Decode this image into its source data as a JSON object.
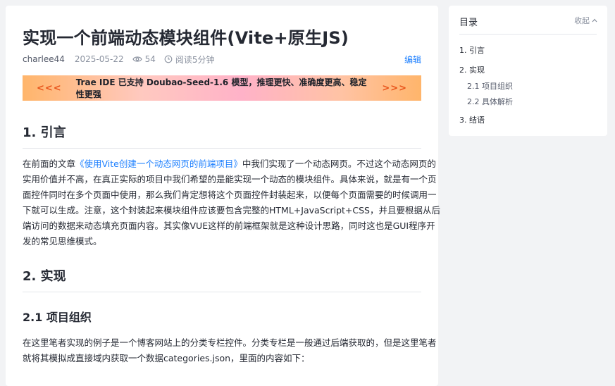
{
  "article": {
    "title": "实现一个前端动态模块组件(Vite+原生JS)",
    "author": "charlee44",
    "date": "2025-05-22",
    "views": "54",
    "read_time": "阅读5分钟",
    "edit_label": "编辑"
  },
  "banner": {
    "left_arrows": "<<<",
    "text": "Trae IDE 已支持 Doubao-Seed-1.6 模型，推理更快、准确度更高、稳定性更强",
    "right_arrows": ">>>"
  },
  "sections": {
    "s1_heading": "1. 引言",
    "s1_lines": [
      {
        "pre": "在前面的文章",
        "link": "《使用Vite创建一个动态网页的前端项目》",
        "post": "中我们实现了一个动态网页。不过这个动态网页的"
      },
      "实用价值并不高，在真正实际的项目中我们希望的是能实现一个动态的模块组件。具体来说，就是有一个页",
      "面控件同时在多个页面中使用，那么我们肯定想将这个页面控件封装起来，以便每个页面需要的时候调用一",
      "下就可以生成。注意，这个封装起来模块组件应该要包含完整的HTML+JavaScript+CSS，并且要根据从后",
      "端访问的数据来动态填充页面内容。其实像VUE这样的前端框架就是这种设计思路，同时这也是GUI程序开",
      "发的常见思维模式。"
    ],
    "s2_heading": "2. 实现",
    "s21_heading": "2.1 项目组织",
    "s21_lines": [
      "在这里笔者实现的例子是一个博客网站上的分类专栏控件。分类专栏是一般通过后端获取的，但是这里笔者",
      "就将其模拟成直接域内获取一个数据categories.json，里面的内容如下："
    ]
  },
  "toc": {
    "title": "目录",
    "collapse_label": "收起",
    "items": [
      "1. 引言",
      "2. 实现",
      "2.1 项目组织",
      "2.2 具体解析",
      "3. 结语"
    ]
  },
  "colors": {
    "accent": "#1e80ff",
    "banner_arrow": "#e8541b",
    "page_bg": "#f2f3f5"
  },
  "icons": [
    "eye-icon",
    "clock-icon",
    "chevron-up-icon"
  ]
}
